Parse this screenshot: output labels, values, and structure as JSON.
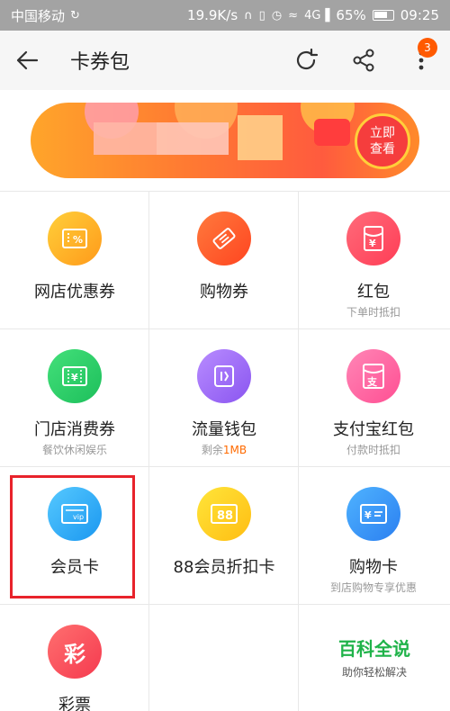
{
  "status_bar": {
    "carrier": "中国移动",
    "speed": "19.9K/s",
    "network": "4G",
    "battery": "65%",
    "time": "09:25"
  },
  "top_bar": {
    "title": "卡券包",
    "menu_badge": "3"
  },
  "banner": {
    "cta": "立即\n查看"
  },
  "grid": [
    {
      "label": "网店优惠券",
      "sub": "",
      "icon": "discount-ticket-icon",
      "color": "#ffb31f"
    },
    {
      "label": "购物券",
      "sub": "",
      "icon": "coupon-ticket-icon",
      "color": "#ff5a2a"
    },
    {
      "label": "红包",
      "sub": "下单时抵扣",
      "icon": "red-envelope-icon",
      "color": "#ff4558"
    },
    {
      "label": "门店消费券",
      "sub": "餐饮休闲娱乐",
      "icon": "store-voucher-icon",
      "color": "#26c862"
    },
    {
      "label": "流量钱包",
      "sub_prefix": "剩余",
      "sub_highlight": "1MB",
      "icon": "data-wallet-icon",
      "color": "#9560f3"
    },
    {
      "label": "支付宝红包",
      "sub": "付款时抵扣",
      "icon": "alipay-envelope-icon",
      "color": "#ff5a9c"
    },
    {
      "label": "会员卡",
      "sub": "",
      "icon": "vip-card-icon",
      "color": "#2aa2f3"
    },
    {
      "label": "88会员折扣卡",
      "sub": "",
      "icon": "88-card-icon",
      "color": "#ffc41a"
    },
    {
      "label": "购物卡",
      "sub": "到店购物专享优惠",
      "icon": "shopping-card-icon",
      "color": "#2f86f1"
    },
    {
      "label": "彩票",
      "sub": "",
      "icon": "lottery-icon",
      "color": "#f54456",
      "icon_text": "彩"
    }
  ],
  "watermark": {
    "title": "百科全说",
    "subtitle": "助你轻松解决"
  }
}
